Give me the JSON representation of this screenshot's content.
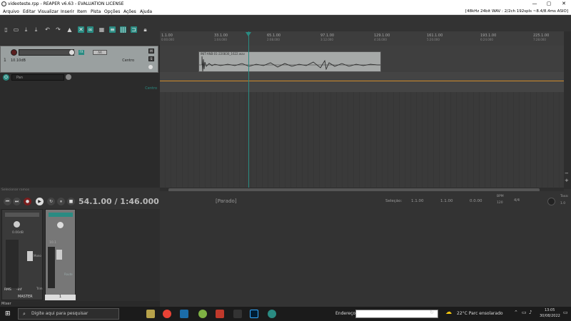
{
  "window": {
    "title": "videoteste.rpp - REAPER v6.63 - EVALUATION LICENSE",
    "controls": [
      "—",
      "▢",
      "✕"
    ]
  },
  "menu": {
    "items": [
      "Arquivo",
      "Editar",
      "Visualizar",
      "Inserir",
      "Item",
      "Pista",
      "Opções",
      "Ações",
      "Ajuda"
    ],
    "status": "[48kHz 24bit WAV : 2/2ch 192spls ~8.4/8.4ms ASIO]"
  },
  "track1": {
    "number": "1",
    "volume": "10.10dB",
    "pan": "Centro",
    "side_buttons": [
      "M",
      "S"
    ],
    "env_label": "ɅɅ",
    "fx_label": "FX"
  },
  "fx_row": {
    "name": "Pan",
    "pan": "Centro"
  },
  "ruler": {
    "ticks": [
      {
        "bar": "1.1.00",
        "time": "0:00.000"
      },
      {
        "bar": "33.1.00",
        "time": "1:04.000"
      },
      {
        "bar": "65.1.00",
        "time": "2:08.000"
      },
      {
        "bar": "97.1.00",
        "time": "3:12.000"
      },
      {
        "bar": "129.1.00",
        "time": "4:16.000"
      },
      {
        "bar": "161.1.00",
        "time": "5:20.000"
      },
      {
        "bar": "193.1.00",
        "time": "6:24.000"
      },
      {
        "bar": "225.1.00",
        "time": "7:28.000"
      }
    ]
  },
  "item": {
    "label": "INIT-ANB:01-220830_1622.wav"
  },
  "transport": {
    "time": "54.1.00 / 1:46.000",
    "state": "[Parado]",
    "selection_label": "Seleção:",
    "sel_start": "1.1.00",
    "sel_end": "1.1.00",
    "sel_len": "0.0.00",
    "bpm_label": "BPM",
    "bpm": "120",
    "sig": "4/4",
    "rate_label": "Taxa:",
    "rate": "1.0",
    "selecionar_label": "Selecionar ramos"
  },
  "mixer": {
    "master_label": "MASTER",
    "track_number": "1",
    "rms_label": "RMS",
    "inf_label": "-inf",
    "master_vol": "0.00dB",
    "track_vol": "10.1",
    "mono": "Mono",
    "route": "Route",
    "trim": "Trim",
    "footer_tab": "Mixer"
  },
  "taskbar": {
    "search_placeholder": "Digite aqui para pesquisar",
    "address_label": "Endereço",
    "weather": "22°C  Parc ensolarado",
    "time": "13:05",
    "date": "30/08/2022"
  },
  "colors": {
    "accent": "#2a8b82",
    "envelope": "#d08a2c",
    "record": "#c0392b"
  }
}
